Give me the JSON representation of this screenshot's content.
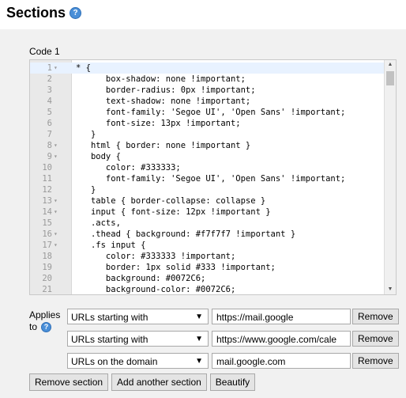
{
  "header": {
    "title": "Sections",
    "help": "?"
  },
  "editor": {
    "label": "Code 1",
    "lines": [
      {
        "n": "1",
        "fold": "▾",
        "text": "* {"
      },
      {
        "n": "2",
        "fold": "",
        "text": "      box-shadow: none !important;"
      },
      {
        "n": "3",
        "fold": "",
        "text": "      border-radius: 0px !important;"
      },
      {
        "n": "4",
        "fold": "",
        "text": "      text-shadow: none !important;"
      },
      {
        "n": "5",
        "fold": "",
        "text": "      font-family: 'Segoe UI', 'Open Sans' !important;"
      },
      {
        "n": "6",
        "fold": "",
        "text": "      font-size: 13px !important;"
      },
      {
        "n": "7",
        "fold": "",
        "text": "   }"
      },
      {
        "n": "8",
        "fold": "▾",
        "text": "   html { border: none !important }"
      },
      {
        "n": "9",
        "fold": "▾",
        "text": "   body {"
      },
      {
        "n": "10",
        "fold": "",
        "text": "      color: #333333;"
      },
      {
        "n": "11",
        "fold": "",
        "text": "      font-family: 'Segoe UI', 'Open Sans' !important;"
      },
      {
        "n": "12",
        "fold": "",
        "text": "   }"
      },
      {
        "n": "13",
        "fold": "▾",
        "text": "   table { border-collapse: collapse }"
      },
      {
        "n": "14",
        "fold": "▾",
        "text": "   input { font-size: 12px !important }"
      },
      {
        "n": "15",
        "fold": "",
        "text": "   .acts,"
      },
      {
        "n": "16",
        "fold": "▾",
        "text": "   .thead { background: #f7f7f7 !important }"
      },
      {
        "n": "17",
        "fold": "▾",
        "text": "   .fs input {"
      },
      {
        "n": "18",
        "fold": "",
        "text": "      color: #333333 !important;"
      },
      {
        "n": "19",
        "fold": "",
        "text": "      border: 1px solid #333 !important;"
      },
      {
        "n": "20",
        "fold": "",
        "text": "      background: #0072C6;"
      },
      {
        "n": "21",
        "fold": "",
        "text": "      background-color: #0072C6;"
      }
    ]
  },
  "applies": {
    "label_line1": "Applies",
    "label_line2": "to",
    "help": "?"
  },
  "rules": [
    {
      "type": "URLs starting with",
      "value": "https://mail.google",
      "remove": "Remove"
    },
    {
      "type": "URLs starting with",
      "value": "https://www.google.com/cale",
      "remove": "Remove"
    },
    {
      "type": "URLs on the domain",
      "value": "mail.google.com",
      "remove": "Remove"
    }
  ],
  "actions": {
    "remove_section": "Remove section",
    "add_section": "Add another section",
    "beautify": "Beautify"
  }
}
